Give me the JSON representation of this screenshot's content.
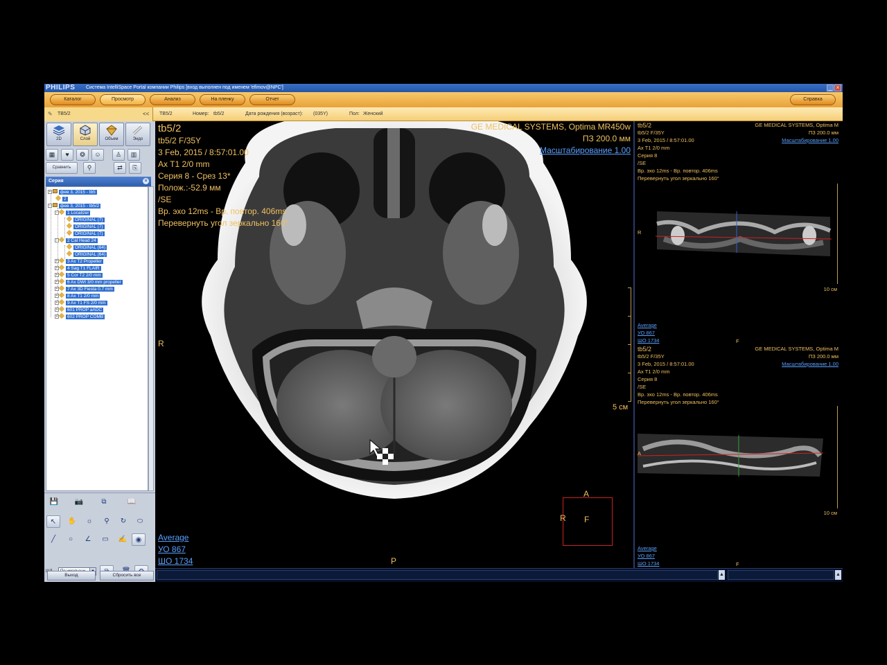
{
  "window": {
    "brand": "PHILIPS",
    "title": "Система IntelliSpace Portal компании Philips [вход выполнен под именем 'efimov@NPC']"
  },
  "toolbar": {
    "tabs": [
      {
        "label": "Каталог"
      },
      {
        "label": "Просмотр"
      },
      {
        "label": "Анализ"
      },
      {
        "label": "На пленку"
      },
      {
        "label": "Отчет"
      }
    ],
    "help_label": "Справка"
  },
  "patient": {
    "id": "TB5/2",
    "collapse_label": "<<",
    "name_label": "TB5/2",
    "number_caption": "Номер:",
    "number_value": "tb5/2",
    "dob_caption": "Дата рождения (возраст):",
    "dob_value": "(035Y)",
    "sex_caption": "Пол:",
    "sex_value": "Женский"
  },
  "modes": [
    {
      "label": "2D"
    },
    {
      "label": "Слой"
    },
    {
      "label": "Объем"
    },
    {
      "label": "Эндо"
    }
  ],
  "compare_label": "Сравнить",
  "series_panel": {
    "header": "Серия",
    "tree": [
      {
        "label": "фев 3, 2015 - tb5",
        "level": 0
      },
      {
        "label": "2",
        "level": 1
      },
      {
        "label": "фев 3, 2015 - tb5/2",
        "level": 0
      },
      {
        "label": "1 Localizer",
        "level": 1
      },
      {
        "label": "ORIGINAL (7)",
        "level": 2
      },
      {
        "label": "ORIGINAL (7)",
        "level": 2
      },
      {
        "label": "ORIGINAL (7)",
        "level": 2
      },
      {
        "label": "2 Cal Head 24",
        "level": 1
      },
      {
        "label": "ORIGINAL (64)",
        "level": 2
      },
      {
        "label": "ORIGINAL (64)",
        "level": 2
      },
      {
        "label": "3 Ax T2 Propeller",
        "level": 1
      },
      {
        "label": "4 Sag T1 FLAIR",
        "level": 1
      },
      {
        "label": "5 Cor T2 2/0 mm",
        "level": 1
      },
      {
        "label": "6 Ax DWI 3/0 mm propeller",
        "level": 1
      },
      {
        "label": "7 Ax 3D Fiesta 0.7 mm",
        "level": 1
      },
      {
        "label": "8 Ax T1 2/0 mm",
        "level": 1
      },
      {
        "label": "9 Ax T1 FS 2/0 mm",
        "level": 1
      },
      {
        "label": "601 PROP aADC",
        "level": 1
      },
      {
        "label": "602 PROP COMB",
        "level": 1
      }
    ]
  },
  "preset": {
    "caption": "ШД",
    "value": "По умолчани"
  },
  "footer": {
    "exit_label": "Выход",
    "reset_label": "Сбросить все"
  },
  "main_view": {
    "series_name": "tb5/2",
    "patient_line": "tb5/2 F/35Y",
    "datetime": "3 Feb, 2015 / 8:57:01.00",
    "protocol": "Ax T1 2/0 mm",
    "series_slice": "Серия 8 - Срез 13*",
    "position": "Полож.:-52.9 мм",
    "sequence": "/SE",
    "timing": "Вр. эхо  12ms - Вр. повтор. 406ms",
    "orientation": "Перевернуть угол зеркально 160°",
    "manufacturer": "GE MEDICAL SYSTEMS, Optima MR450w",
    "fov": "ПЗ 200.0 мм",
    "zoom": "Масштабирование 1.00",
    "marker_left": "R",
    "marker_bottom": "P",
    "scale_label": "5 см",
    "wl_mode": "Average",
    "wl_level": "УО   867",
    "wl_width": "ШО  1734",
    "cube": {
      "top": "A",
      "left": "R",
      "center": "F"
    }
  },
  "side_views": [
    {
      "series_name": "tb5/2",
      "patient_line": "tb5/2 F/35Y",
      "datetime": "3 Feb, 2015 / 8:57:01.00",
      "protocol": "Ax T1 2/0 mm",
      "series": "Серия 8",
      "sequence": "/SE",
      "timing": "Вр. эхо  12ms - Вр. повтор. 406ms",
      "orientation": "Перевернуть угол зеркально 160°",
      "manufacturer": "GE MEDICAL SYSTEMS, Optima M",
      "fov": "ПЗ 200.0 мм",
      "zoom": "Масштабирование 1.00",
      "marker_left": "R",
      "marker_bottom": "F",
      "scale_label": "10 см",
      "wl_mode": "Average",
      "wl_level": "УО   867",
      "wl_width": "ШО  1734"
    },
    {
      "series_name": "tb5/2",
      "patient_line": "tb5/2 F/35Y",
      "datetime": "3 Feb, 2015 / 8:57:01.00",
      "protocol": "Ax T1 2/0 mm",
      "series": "Серия 8",
      "sequence": "/SE",
      "timing": "Вр. эхо  12ms - Вр. повтор. 406ms",
      "orientation": "Перевернуть угол зеркально 160°",
      "manufacturer": "GE MEDICAL SYSTEMS, Optima M",
      "fov": "ПЗ 200.0 мм",
      "zoom": "Масштабирование 1.00",
      "marker_left": "A",
      "marker_bottom": "F",
      "scale_label": "10 см",
      "wl_mode": "Average",
      "wl_level": "УО   867",
      "wl_width": "ШО  1734"
    }
  ],
  "colors": {
    "overlay_text": "#f0c060",
    "overlay_link": "#5aa0ff",
    "toolbar_orange": "#e9a23a",
    "tree_selection": "#2f6fd0",
    "cube_red": "#d02020"
  }
}
